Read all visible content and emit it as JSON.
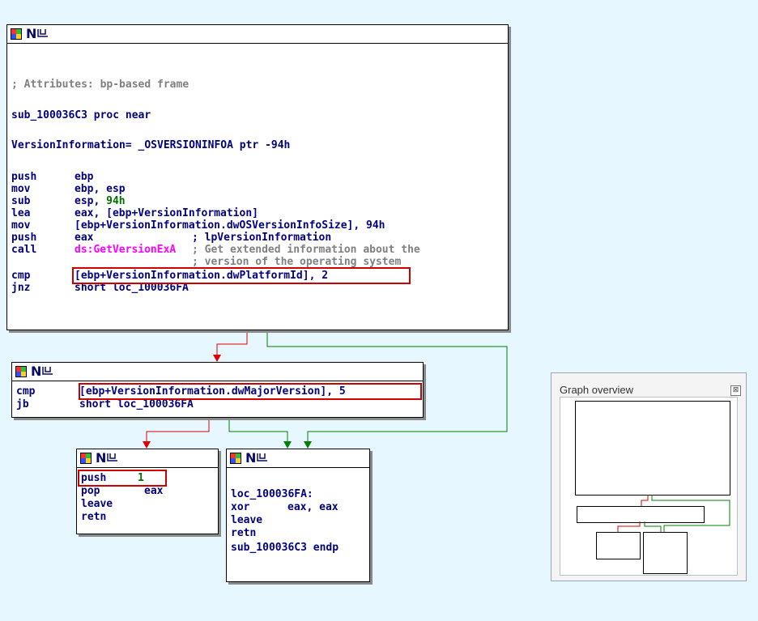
{
  "block1": {
    "lines": [
      {
        "text": "; Attributes: bp-based frame"
      },
      {
        "text": "sub_100036C3 proc near"
      },
      {
        "text": "VersionInformation= _OSVERSIONINFOA ptr -94h"
      },
      {
        "op": "push",
        "args": "ebp"
      },
      {
        "op": "mov",
        "args": "ebp, esp"
      },
      {
        "op": "sub",
        "args": "esp, 94h"
      },
      {
        "op": "lea",
        "args": "eax, [ebp+VersionInformation]"
      },
      {
        "op": "mov",
        "args": "[ebp+VersionInformation.dwOSVersionInfoSize], 94h"
      },
      {
        "op": "push",
        "args": "eax",
        "comment": "; lpVersionInformation"
      },
      {
        "op": "call",
        "args": "ds:GetVersionExA",
        "comment": "; Get extended information about the"
      },
      {
        "comment2": "; version of the operating system"
      },
      {
        "op": "cmp",
        "args": "[ebp+VersionInformation.dwPlatformId], 2"
      },
      {
        "op": "jnz",
        "args": "short loc_100036FA"
      }
    ]
  },
  "block2": {
    "lines": [
      {
        "op": "cmp",
        "args": "[ebp+VersionInformation.dwMajorVersion], 5"
      },
      {
        "op": "jb",
        "args": "short loc_100036FA"
      }
    ]
  },
  "block3": {
    "lines": [
      {
        "op": "push",
        "args": "1"
      },
      {
        "op": "pop",
        "args": "eax"
      },
      {
        "op": "leave",
        "args": ""
      },
      {
        "op": "retn",
        "args": ""
      }
    ]
  },
  "block4": {
    "lines": [
      {
        "text": "loc_100036FA:"
      },
      {
        "op": "xor",
        "args": "eax, eax"
      },
      {
        "op": "leave",
        "args": ""
      },
      {
        "op": "retn",
        "args": ""
      },
      {
        "text": "sub_100036C3 endp"
      }
    ]
  },
  "overview": {
    "title": "Graph overview",
    "close": "⊠"
  },
  "colors": {
    "edge_true": "#008000",
    "edge_false": "#e00000",
    "edge_uncond": "#0000cc",
    "highlight": "#cc0000"
  }
}
